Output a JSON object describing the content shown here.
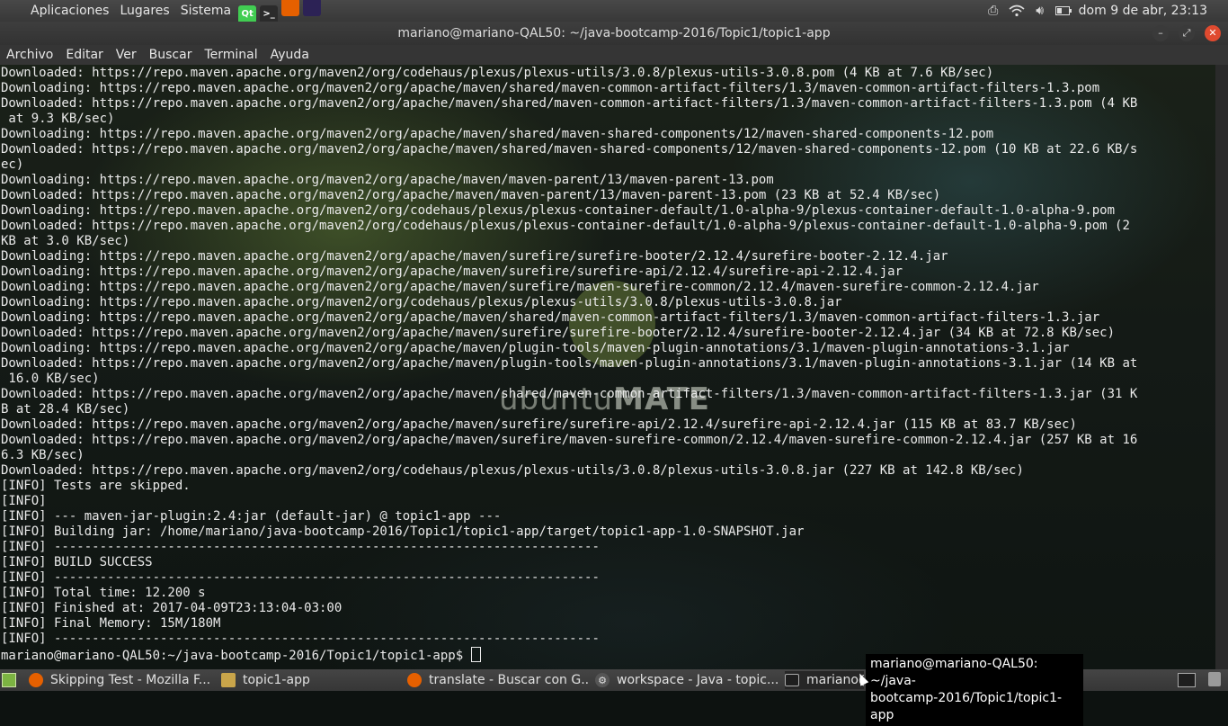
{
  "top_panel": {
    "menus": [
      "Aplicaciones",
      "Lugares",
      "Sistema"
    ],
    "launchers": [
      {
        "name": "qt-creator-launcher",
        "icon": "qt-icon",
        "glyph": "Qt",
        "color": "#41cd52"
      },
      {
        "name": "terminal-launcher",
        "icon": "terminal-icon",
        "glyph": ">_",
        "color": "#2b2b2b"
      },
      {
        "name": "firefox-launcher",
        "icon": "firefox-icon",
        "glyph": "",
        "color": "#e66000"
      },
      {
        "name": "eclipse-launcher",
        "icon": "eclipse-icon",
        "glyph": "",
        "color": "#2c2255"
      }
    ],
    "tray_icons": [
      "printer-icon",
      "wifi-icon",
      "volume-icon",
      "battery-icon"
    ],
    "clock": "dom  9 de abr, 23:13"
  },
  "window": {
    "title": "mariano@mariano-QAL50: ~/java-bootcamp-2016/Topic1/topic1-app",
    "buttons": {
      "minimize": "–",
      "maximize": "⤢",
      "close": "✕"
    }
  },
  "menubar": {
    "items": [
      "Archivo",
      "Editar",
      "Ver",
      "Buscar",
      "Terminal",
      "Ayuda"
    ]
  },
  "terminal": {
    "watermark": {
      "prefix": "ubuntu",
      "brand": "MATE"
    },
    "lines": [
      "Downloaded: https://repo.maven.apache.org/maven2/org/codehaus/plexus/plexus-utils/3.0.8/plexus-utils-3.0.8.pom (4 KB at 7.6 KB/sec)",
      "Downloading: https://repo.maven.apache.org/maven2/org/apache/maven/shared/maven-common-artifact-filters/1.3/maven-common-artifact-filters-1.3.pom",
      "Downloaded: https://repo.maven.apache.org/maven2/org/apache/maven/shared/maven-common-artifact-filters/1.3/maven-common-artifact-filters-1.3.pom (4 KB",
      " at 9.3 KB/sec)",
      "Downloading: https://repo.maven.apache.org/maven2/org/apache/maven/shared/maven-shared-components/12/maven-shared-components-12.pom",
      "Downloaded: https://repo.maven.apache.org/maven2/org/apache/maven/shared/maven-shared-components/12/maven-shared-components-12.pom (10 KB at 22.6 KB/s",
      "ec)",
      "Downloading: https://repo.maven.apache.org/maven2/org/apache/maven/maven-parent/13/maven-parent-13.pom",
      "Downloaded: https://repo.maven.apache.org/maven2/org/apache/maven/maven-parent/13/maven-parent-13.pom (23 KB at 52.4 KB/sec)",
      "Downloading: https://repo.maven.apache.org/maven2/org/codehaus/plexus/plexus-container-default/1.0-alpha-9/plexus-container-default-1.0-alpha-9.pom",
      "Downloaded: https://repo.maven.apache.org/maven2/org/codehaus/plexus/plexus-container-default/1.0-alpha-9/plexus-container-default-1.0-alpha-9.pom (2",
      "KB at 3.0 KB/sec)",
      "Downloading: https://repo.maven.apache.org/maven2/org/apache/maven/surefire/surefire-booter/2.12.4/surefire-booter-2.12.4.jar",
      "Downloading: https://repo.maven.apache.org/maven2/org/apache/maven/surefire/surefire-api/2.12.4/surefire-api-2.12.4.jar",
      "Downloading: https://repo.maven.apache.org/maven2/org/apache/maven/surefire/maven-surefire-common/2.12.4/maven-surefire-common-2.12.4.jar",
      "Downloading: https://repo.maven.apache.org/maven2/org/codehaus/plexus/plexus-utils/3.0.8/plexus-utils-3.0.8.jar",
      "Downloading: https://repo.maven.apache.org/maven2/org/apache/maven/shared/maven-common-artifact-filters/1.3/maven-common-artifact-filters-1.3.jar",
      "Downloaded: https://repo.maven.apache.org/maven2/org/apache/maven/surefire/surefire-booter/2.12.4/surefire-booter-2.12.4.jar (34 KB at 72.8 KB/sec)",
      "Downloading: https://repo.maven.apache.org/maven2/org/apache/maven/plugin-tools/maven-plugin-annotations/3.1/maven-plugin-annotations-3.1.jar",
      "Downloaded: https://repo.maven.apache.org/maven2/org/apache/maven/plugin-tools/maven-plugin-annotations/3.1/maven-plugin-annotations-3.1.jar (14 KB at",
      " 16.0 KB/sec)",
      "Downloaded: https://repo.maven.apache.org/maven2/org/apache/maven/shared/maven-common-artifact-filters/1.3/maven-common-artifact-filters-1.3.jar (31 K",
      "B at 28.4 KB/sec)",
      "Downloaded: https://repo.maven.apache.org/maven2/org/apache/maven/surefire/surefire-api/2.12.4/surefire-api-2.12.4.jar (115 KB at 83.7 KB/sec)",
      "Downloaded: https://repo.maven.apache.org/maven2/org/apache/maven/surefire/maven-surefire-common/2.12.4/maven-surefire-common-2.12.4.jar (257 KB at 16",
      "6.3 KB/sec)",
      "Downloaded: https://repo.maven.apache.org/maven2/org/codehaus/plexus/plexus-utils/3.0.8/plexus-utils-3.0.8.jar (227 KB at 142.8 KB/sec)",
      "[INFO] Tests are skipped.",
      "[INFO]",
      "[INFO] --- maven-jar-plugin:2.4:jar (default-jar) @ topic1-app ---",
      "[INFO] Building jar: /home/mariano/java-bootcamp-2016/Topic1/topic1-app/target/topic1-app-1.0-SNAPSHOT.jar",
      "[INFO] ------------------------------------------------------------------------",
      "[INFO] BUILD SUCCESS",
      "[INFO] ------------------------------------------------------------------------",
      "[INFO] Total time: 12.200 s",
      "[INFO] Finished at: 2017-04-09T23:13:04-03:00",
      "[INFO] Final Memory: 15M/180M",
      "[INFO] ------------------------------------------------------------------------"
    ],
    "prompt": "mariano@mariano-QAL50:~/java-bootcamp-2016/Topic1/topic1-app$ "
  },
  "taskbar": {
    "tasks": [
      {
        "label": "Skipping Test - Mozilla F...",
        "icon": "firefox-icon",
        "active": false
      },
      {
        "label": "topic1-app",
        "icon": "folder-icon",
        "active": false
      },
      {
        "label": "translate - Buscar con G...",
        "icon": "firefox-icon",
        "active": false
      },
      {
        "label": "workspace - Java - topic...",
        "icon": "eclipse-icon",
        "active": false
      },
      {
        "label": "mariano@mariano-QAL50: ~/java-bootca...",
        "icon": "terminal-icon",
        "active": true
      }
    ],
    "tray_icons": [
      "terminal-icon",
      "trash-icon"
    ]
  },
  "tooltip": {
    "line1": "mariano@mariano-QAL50: ~/java-",
    "line2": "bootcamp-2016/Topic1/topic1-app"
  }
}
